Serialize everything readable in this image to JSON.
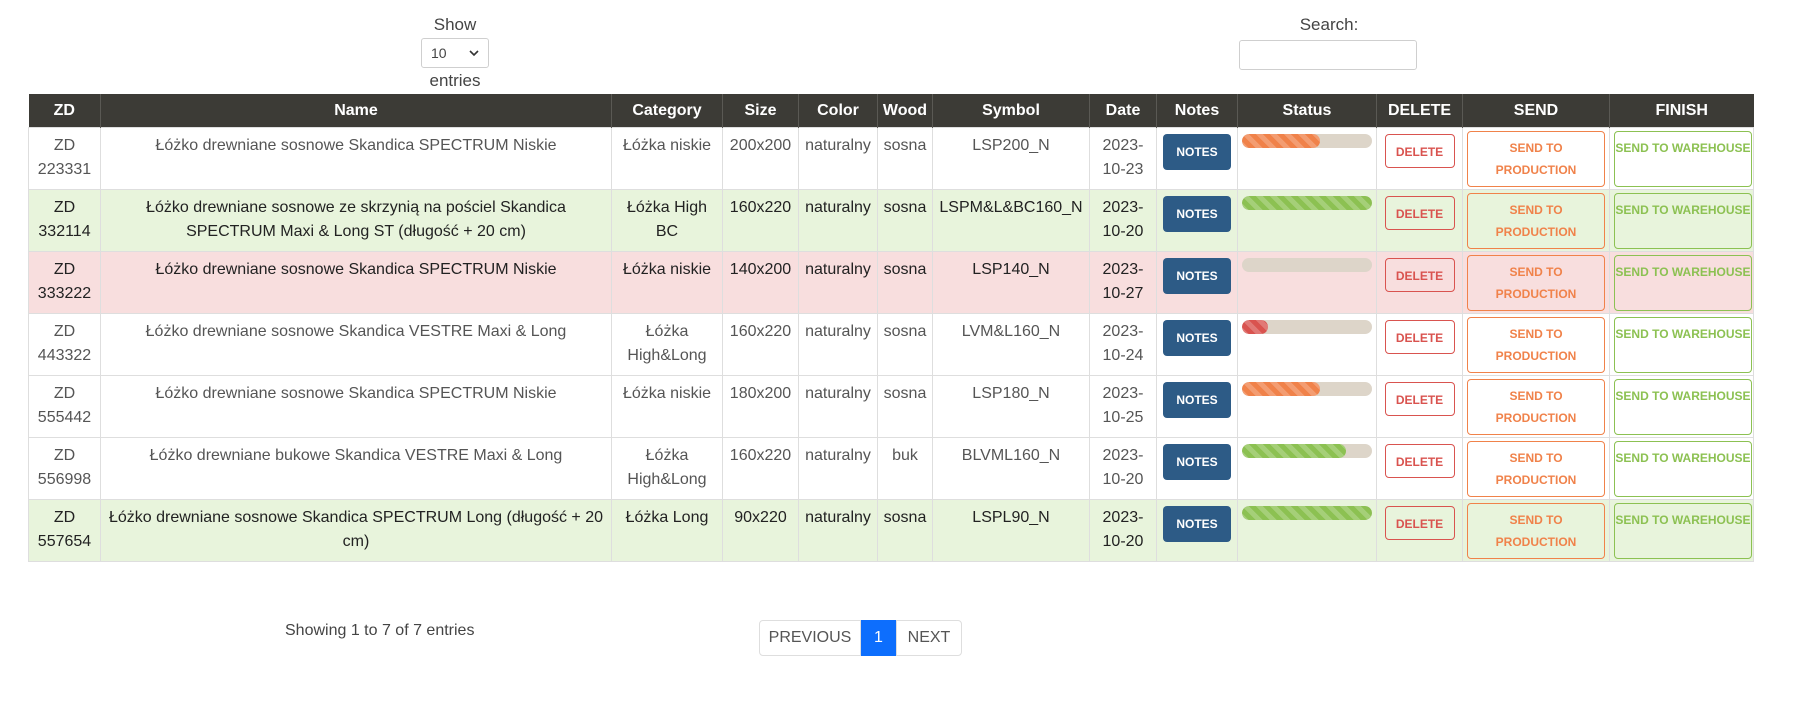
{
  "controls": {
    "show_label": "Show",
    "entries_label": "entries",
    "page_length": "10",
    "search_label": "Search:",
    "search_value": ""
  },
  "table": {
    "headers": [
      "ZD",
      "Name",
      "Category",
      "Size",
      "Color",
      "Wood",
      "Symbol",
      "Date",
      "Notes",
      "Status",
      "DELETE",
      "SEND",
      "FINISH"
    ],
    "rows": [
      {
        "zd": "ZD 223331",
        "name": "Łóżko drewniane sosnowe Skandica SPECTRUM Niskie",
        "category": "Łóżka niskie",
        "size": "200x200",
        "color": "naturalny",
        "wood": "sosna",
        "symbol": "LSP200_N",
        "date": "2023-10-23",
        "notes": "NOTES",
        "delete": "DELETE",
        "send": "SEND TO PRODUCTION",
        "finish": "SEND TO WAREHOUSE",
        "row_state": "white",
        "status_progress": 0.6,
        "status_color": "orange"
      },
      {
        "zd": "ZD 332114",
        "name": "Łóżko drewniane sosnowe ze skrzynią na pościel Skandica SPECTRUM Maxi & Long ST (długość + 20 cm)",
        "category": "Łóżka High BC",
        "size": "160x220",
        "color": "naturalny",
        "wood": "sosna",
        "symbol": "LSPM&L&BC160_N",
        "date": "2023-10-20",
        "notes": "NOTES",
        "delete": "DELETE",
        "send": "SEND TO PRODUCTION",
        "finish": "SEND TO WAREHOUSE",
        "row_state": "green",
        "status_progress": 1.0,
        "status_color": "green"
      },
      {
        "zd": "ZD 333222",
        "name": "Łóżko drewniane sosnowe Skandica SPECTRUM Niskie",
        "category": "Łóżka niskie",
        "size": "140x200",
        "color": "naturalny",
        "wood": "sosna",
        "symbol": "LSP140_N",
        "date": "2023-10-27",
        "notes": "NOTES",
        "delete": "DELETE",
        "send": "SEND TO PRODUCTION",
        "finish": "SEND TO WAREHOUSE",
        "row_state": "red",
        "status_progress": 0.0,
        "status_color": "orange"
      },
      {
        "zd": "ZD 443322",
        "name": "Łóżko drewniane sosnowe Skandica VESTRE Maxi & Long",
        "category": "Łóżka High&Long",
        "size": "160x220",
        "color": "naturalny",
        "wood": "sosna",
        "symbol": "LVM&L160_N",
        "date": "2023-10-24",
        "notes": "NOTES",
        "delete": "DELETE",
        "send": "SEND TO PRODUCTION",
        "finish": "SEND TO WAREHOUSE",
        "row_state": "white",
        "status_progress": 0.2,
        "status_color": "red"
      },
      {
        "zd": "ZD 555442",
        "name": "Łóżko drewniane sosnowe Skandica SPECTRUM Niskie",
        "category": "Łóżka niskie",
        "size": "180x200",
        "color": "naturalny",
        "wood": "sosna",
        "symbol": "LSP180_N",
        "date": "2023-10-25",
        "notes": "NOTES",
        "delete": "DELETE",
        "send": "SEND TO PRODUCTION",
        "finish": "SEND TO WAREHOUSE",
        "row_state": "white",
        "status_progress": 0.6,
        "status_color": "orange"
      },
      {
        "zd": "ZD 556998",
        "name": "Łóżko drewniane bukowe Skandica VESTRE Maxi & Long",
        "category": "Łóżka High&Long",
        "size": "160x220",
        "color": "naturalny",
        "wood": "buk",
        "symbol": "BLVML160_N",
        "date": "2023-10-20",
        "notes": "NOTES",
        "delete": "DELETE",
        "send": "SEND TO PRODUCTION",
        "finish": "SEND TO WAREHOUSE",
        "row_state": "white",
        "status_progress": 0.8,
        "status_color": "green"
      },
      {
        "zd": "ZD 557654",
        "name": "Łóżko drewniane sosnowe Skandica SPECTRUM Long (długość + 20 cm)",
        "category": "Łóżka Long",
        "size": "90x220",
        "color": "naturalny",
        "wood": "sosna",
        "symbol": "LSPL90_N",
        "date": "2023-10-20",
        "notes": "NOTES",
        "delete": "DELETE",
        "send": "SEND TO PRODUCTION",
        "finish": "SEND TO WAREHOUSE",
        "row_state": "green",
        "status_progress": 1.0,
        "status_color": "green"
      }
    ]
  },
  "footer": {
    "info": "Showing 1 to 7 of 7 entries",
    "prev_label": "PREVIOUS",
    "current_page": "1",
    "next_label": "NEXT"
  },
  "colors": {
    "header_bg": "#3c3b36",
    "notes_btn": "#2d5b86",
    "delete": "#d9534f",
    "send": "#f0824a",
    "finish": "#8cc152",
    "row_green": "#e8f4dc",
    "row_red": "#f8dede",
    "page_active": "#0d6efd"
  }
}
